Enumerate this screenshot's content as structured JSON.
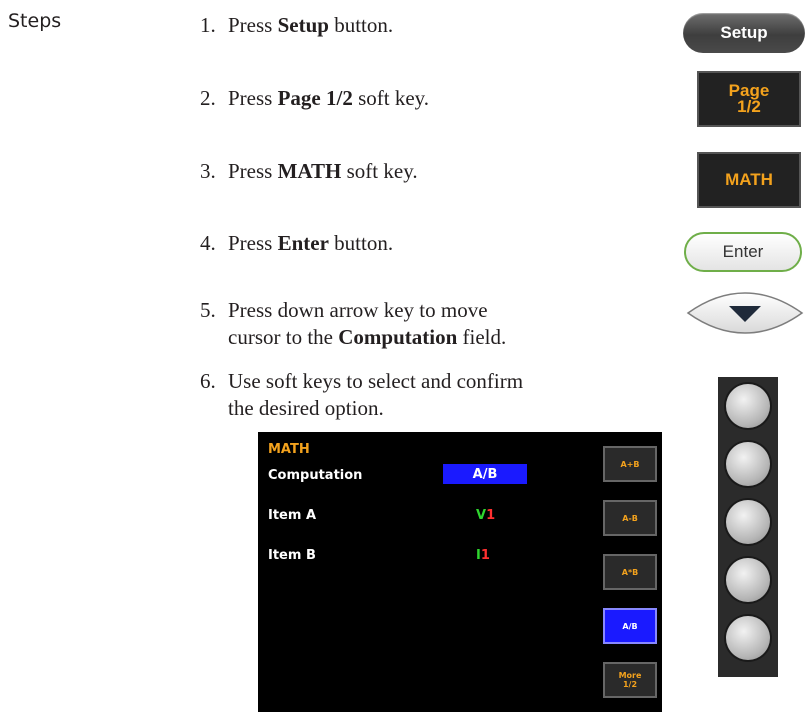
{
  "section": {
    "label": "Steps"
  },
  "steps": [
    {
      "num": "1.",
      "pre": "Press ",
      "bold": "Setup",
      "post": " button."
    },
    {
      "num": "2.",
      "pre": "Press ",
      "bold": "Page 1/2",
      "post": " soft key."
    },
    {
      "num": "3.",
      "pre": "Press ",
      "bold": "MATH",
      "post": " soft key."
    },
    {
      "num": "4.",
      "pre": "Press ",
      "bold": "Enter",
      "post": " button."
    },
    {
      "num": "5.",
      "line1": "Press down arrow key to move",
      "line2_pre": "cursor to the ",
      "line2_bold": "Computation",
      "line2_post": " field."
    },
    {
      "num": "6.",
      "line1": "Use soft keys to select and confirm",
      "line2": "the desired option."
    }
  ],
  "buttons": {
    "setup": "Setup",
    "page_line1": "Page",
    "page_line2": "1/2",
    "math": "MATH",
    "enter": "Enter"
  },
  "screen": {
    "title": "MATH",
    "computation_label": "Computation",
    "computation_value": "A/B",
    "item_a_label": "Item A",
    "item_a_letter": "V",
    "item_a_num": "1",
    "item_b_label": "Item B",
    "item_b_letter": "I",
    "item_b_num": "1",
    "softkeys": [
      "A+B",
      "A-B",
      "A*B",
      "A/B"
    ],
    "more_line1": "More",
    "more_line2": "1/2"
  },
  "colors": {
    "accent_orange": "#f3a21d",
    "highlight_blue": "#1a1aff",
    "green": "#2fd62f",
    "red": "#ff3030"
  }
}
